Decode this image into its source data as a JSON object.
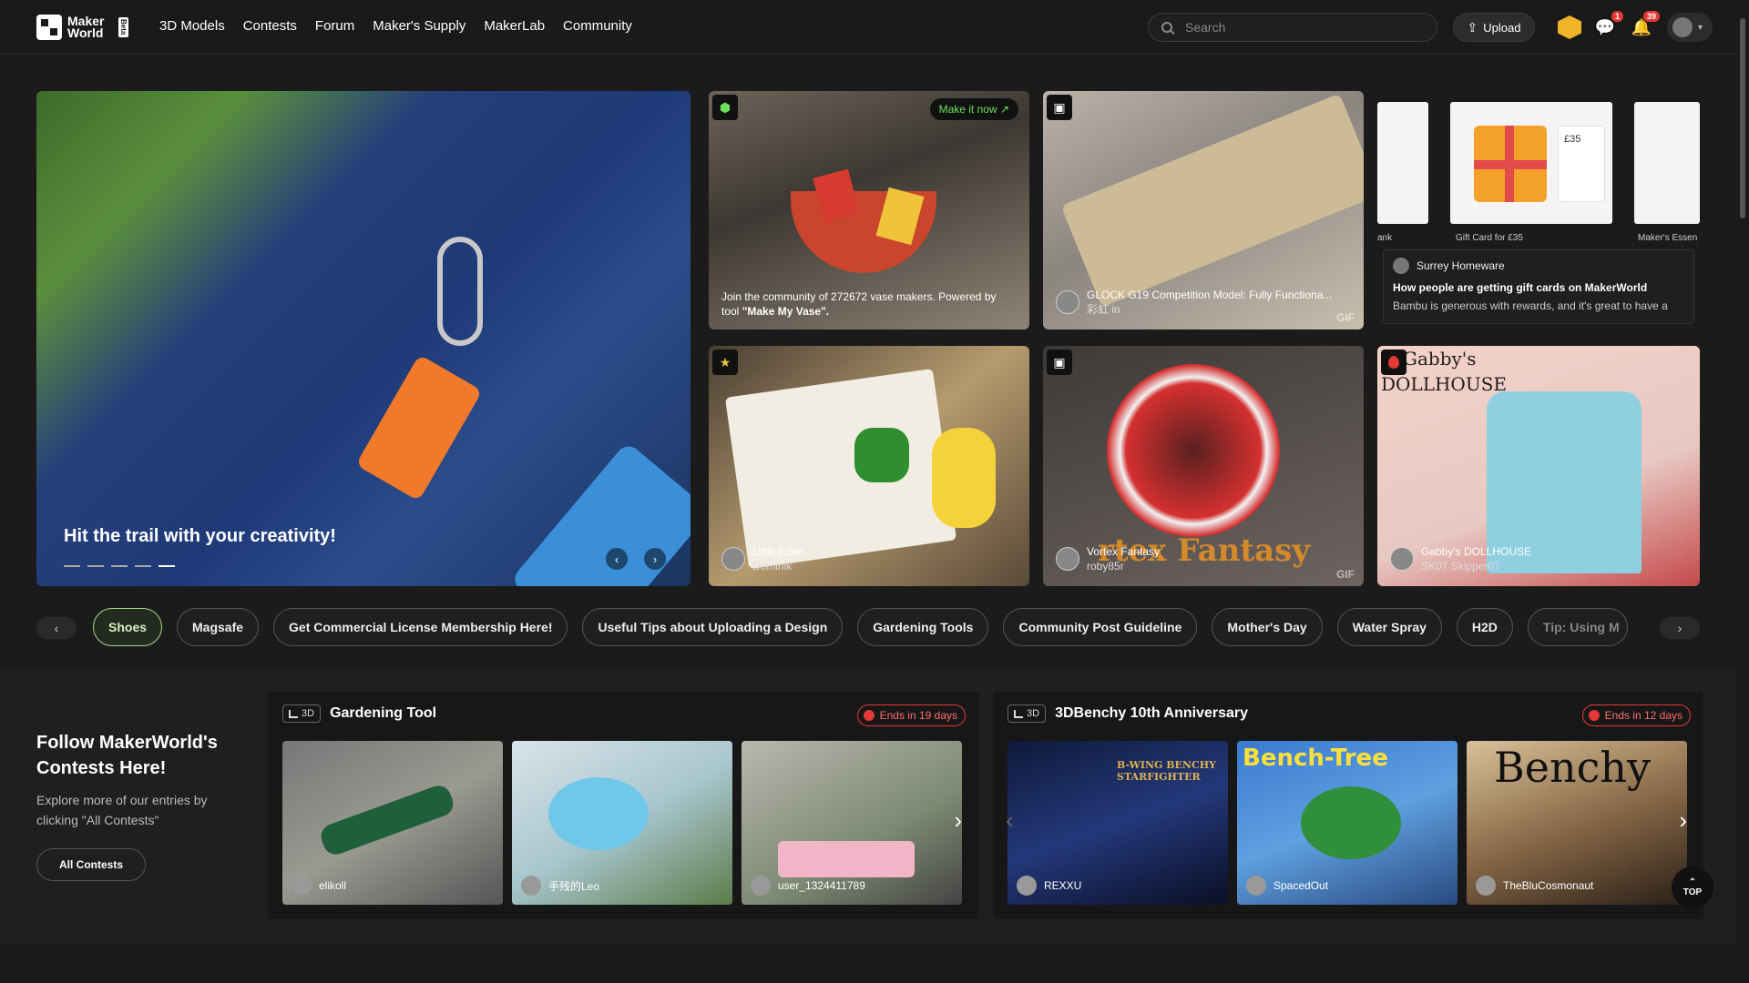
{
  "nav": {
    "logo_text": "Maker World",
    "logo_beta": "Beta",
    "menu": [
      "3D Models",
      "Contests",
      "Forum",
      "Maker's Supply",
      "MakerLab",
      "Community"
    ],
    "search_placeholder": "Search",
    "upload_label": "Upload",
    "messages_badge": "1",
    "notifications_badge": "39"
  },
  "hero": {
    "title": "Hit the trail with your creativity!",
    "prev": "‹",
    "next": "›"
  },
  "tiles": {
    "vase": {
      "make_now": "Make it now ↗",
      "caption_pre": "Join the community of 272672 vase makers. Powered by tool ",
      "caption_tool": "\"Make My Vase\"."
    },
    "glock": {
      "title": "GLOCK G19 Competition Model: Fully Functiona...",
      "author": "彩虹 in",
      "gif": "GIF"
    },
    "gift": {
      "caption_left": "ank",
      "caption_mid": "Gift Card for £35",
      "caption_right": "Maker's Essen",
      "price": "£35",
      "popup_user": "Surrey Homeware",
      "popup_title": "How people are getting gift cards on MakerWorld",
      "popup_text": "Bambu is generous with rewards, and it's great to have a"
    },
    "eden": {
      "title": "Little Eden",
      "author": "Dominik"
    },
    "vortex": {
      "title": "Vortex Fantasy",
      "author": "roby85r",
      "overlay": "rtex Fantasy",
      "gif": "GIF"
    },
    "dollhouse": {
      "overlay_line1": "Gabby's",
      "overlay_line2": "DOLLHOUSE",
      "title": "Gabby's DOLLHOUSE",
      "author": "SK07 Skipper07"
    }
  },
  "chips": [
    "Shoes",
    "Magsafe",
    "Get Commercial License Membership Here!",
    "Useful Tips about Uploading a Design",
    "Gardening Tools",
    "Community Post Guideline",
    "Mother's Day",
    "Water Spray",
    "H2D",
    "Tip: Using M"
  ],
  "contests": {
    "follow_title": "Follow MakerWorld's Contests Here!",
    "follow_desc": "Explore more of our entries by clicking \"All Contests\"",
    "all_button": "All Contests",
    "items": [
      {
        "tag": "3D",
        "title": "Gardening Tool",
        "ends": "Ends in 19 days",
        "users": [
          "elikoll",
          "手残的Leo",
          "user_1324411789"
        ]
      },
      {
        "tag": "3D",
        "title": "3DBenchy 10th Anniversary",
        "ends": "Ends in 12 days",
        "users": [
          "REXXU",
          "SpacedOut",
          "TheBluCosmonaut"
        ],
        "img_titles": [
          "B-WING BENCHY STARFIGHTER",
          "Bench-Tree",
          "Benchy"
        ]
      }
    ]
  },
  "top_button": "TOP"
}
